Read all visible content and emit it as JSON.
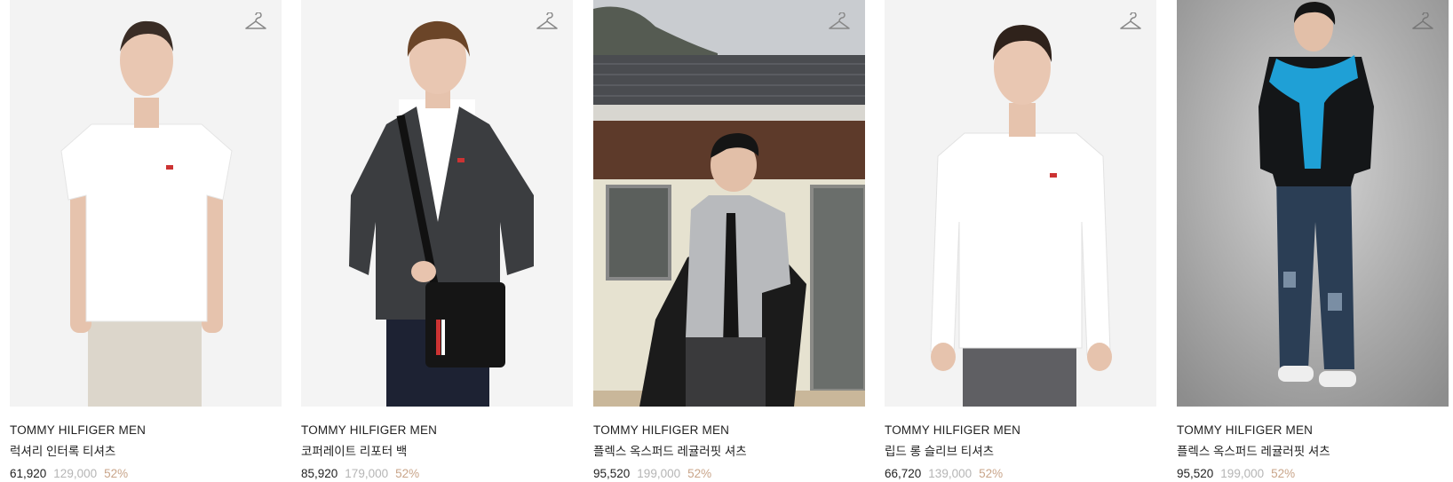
{
  "products": [
    {
      "brand": "TOMMY HILFIGER MEN",
      "name": "럭셔리 인터록 티셔츠",
      "sale_price": "61,920",
      "original_price": "129,000",
      "discount": "52%",
      "wishlist_icon": "hanger-icon"
    },
    {
      "brand": "TOMMY HILFIGER MEN",
      "name": "코퍼레이트 리포터 백",
      "sale_price": "85,920",
      "original_price": "179,000",
      "discount": "52%",
      "wishlist_icon": "hanger-icon"
    },
    {
      "brand": "TOMMY HILFIGER MEN",
      "name": "플렉스 옥스퍼드 레귤러핏 셔츠",
      "sale_price": "95,520",
      "original_price": "199,000",
      "discount": "52%",
      "wishlist_icon": "hanger-icon"
    },
    {
      "brand": "TOMMY HILFIGER MEN",
      "name": "립드 롱 슬리브 티셔츠",
      "sale_price": "66,720",
      "original_price": "139,000",
      "discount": "52%",
      "wishlist_icon": "hanger-icon"
    },
    {
      "brand": "TOMMY HILFIGER MEN",
      "name": "플렉스 옥스퍼드 레귤러핏 셔츠",
      "sale_price": "95,520",
      "original_price": "199,000",
      "discount": "52%",
      "wishlist_icon": "hanger-icon"
    }
  ],
  "colors": {
    "discount": "#c9a58a",
    "original_price": "#b5b5b5",
    "text": "#222222"
  }
}
